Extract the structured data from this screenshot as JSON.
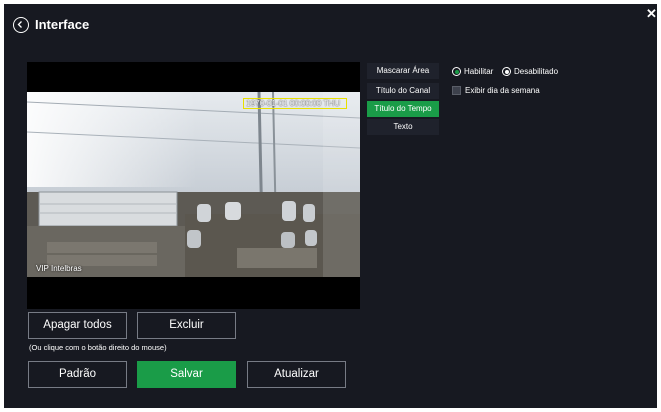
{
  "header": {
    "title": "Interface"
  },
  "video": {
    "time_title": "1970-01-01 00:00:00 THU",
    "channel_title": "VIP Intelbras"
  },
  "tabs": [
    {
      "label": "Mascarar Área"
    },
    {
      "label": "Título do Canal"
    },
    {
      "label": "Título do Tempo",
      "active": true
    },
    {
      "label": "Texto"
    }
  ],
  "options": {
    "enable_label": "Habilitar",
    "disable_label": "Desabilitado",
    "selected": "Habilitar",
    "weekday_label": "Exibir dia da semana",
    "weekday_checked": false
  },
  "buttons": {
    "clear_all": "Apagar todos",
    "delete": "Excluir",
    "hint": "(Ou clique com o botão direito do mouse)",
    "default": "Padrão",
    "save": "Salvar",
    "refresh": "Atualizar"
  },
  "colors": {
    "accent": "#1a9c48",
    "panel_bg": "#171921",
    "tab_bg": "#1f222c",
    "time_box": "#e8e000"
  }
}
